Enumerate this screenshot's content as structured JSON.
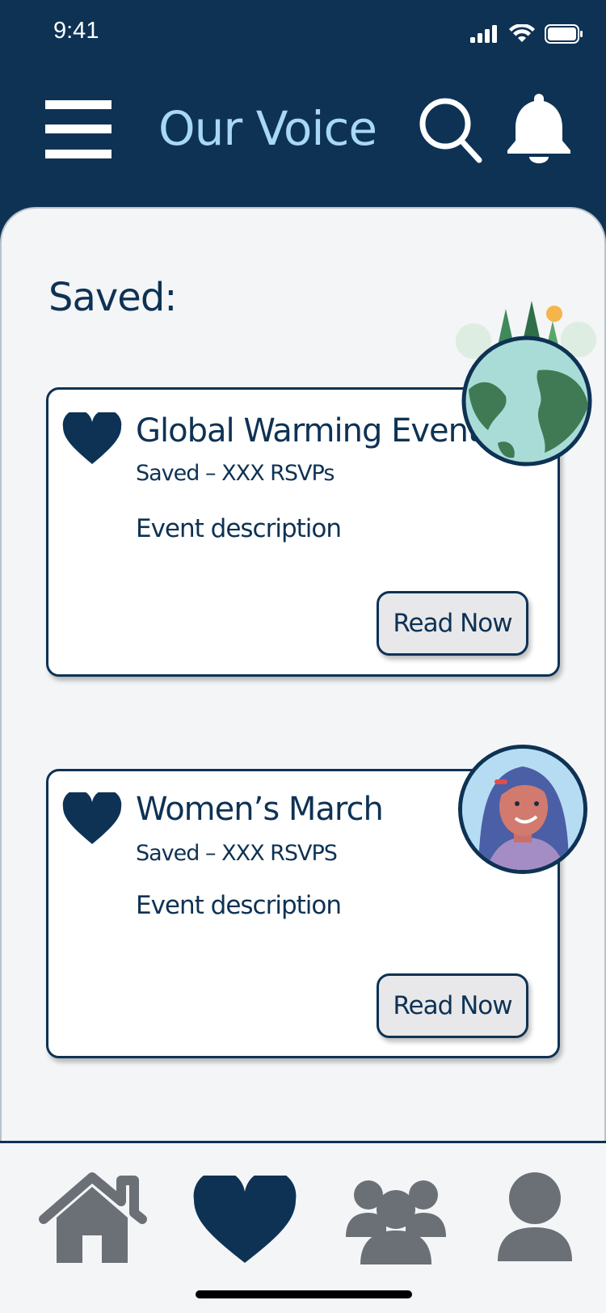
{
  "status_bar": {
    "time": "9:41"
  },
  "header": {
    "title": "Our Voice"
  },
  "section": {
    "title": "Saved:"
  },
  "cards": [
    {
      "title": "Global Warming Event",
      "meta": "Saved – XXX RSVPs",
      "description": "Event description",
      "button_label": "Read Now",
      "image": "earth-forest-illustration"
    },
    {
      "title": "Women’s March",
      "meta": "Saved – XXX RSVPS",
      "description": "Event description",
      "button_label": "Read Now",
      "image": "woman-portrait-illustration"
    }
  ],
  "nav": {
    "items": [
      {
        "icon": "home-icon",
        "active": false
      },
      {
        "icon": "heart-icon",
        "active": true
      },
      {
        "icon": "group-icon",
        "active": false
      },
      {
        "icon": "profile-icon",
        "active": false
      }
    ]
  },
  "colors": {
    "primary": "#0e3254",
    "accent": "#a8d8f5",
    "background": "#f3f5f7",
    "inactive_nav": "#6b6f76",
    "button_bg": "#e8e8ea"
  }
}
